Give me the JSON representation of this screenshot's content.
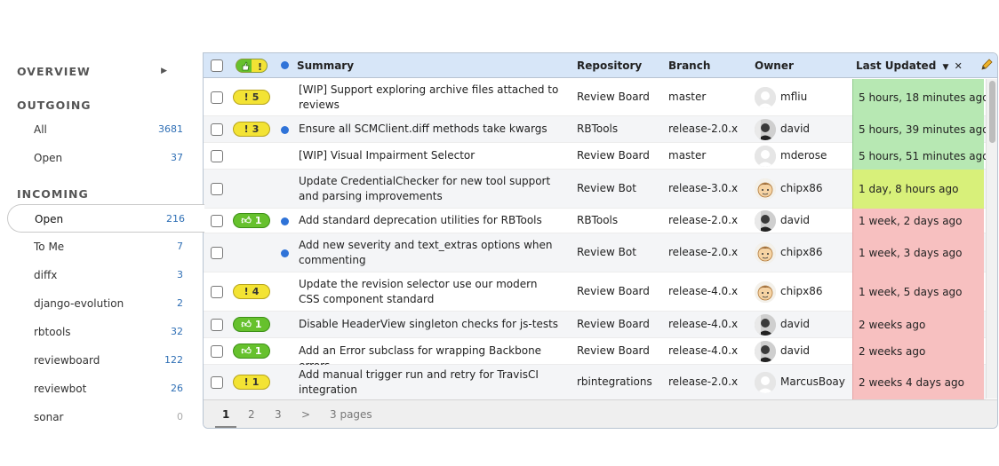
{
  "sidebar": {
    "overview": "OVERVIEW",
    "outgoing": "OUTGOING",
    "incoming": "INCOMING",
    "outgoing_items": [
      {
        "label": "All",
        "count": "3681"
      },
      {
        "label": "Open",
        "count": "37"
      }
    ],
    "incoming_items": [
      {
        "label": "Open",
        "count": "216"
      },
      {
        "label": "To Me",
        "count": "7"
      },
      {
        "label": "diffx",
        "count": "3"
      },
      {
        "label": "django-evolution",
        "count": "2"
      },
      {
        "label": "rbtools",
        "count": "32"
      },
      {
        "label": "reviewboard",
        "count": "122"
      },
      {
        "label": "reviewbot",
        "count": "26"
      },
      {
        "label": "sonar",
        "count": "0"
      }
    ]
  },
  "table": {
    "headers": {
      "summary": "Summary",
      "repository": "Repository",
      "branch": "Branch",
      "owner": "Owner",
      "last_updated": "Last Updated"
    },
    "rows": [
      {
        "badge": "5",
        "badge_color": "yellow",
        "dot": false,
        "summary": "[WIP] Support exploring archive files attached to reviews",
        "summary2": "",
        "repository": "Review Board",
        "branch": "master",
        "owner": "mfliu",
        "avatar": "blank",
        "updated": "5 hours, 18 minutes ago",
        "age": "fresh"
      },
      {
        "badge": "3",
        "badge_color": "yellow",
        "dot": true,
        "summary": "Ensure all SCMClient.diff methods take kwargs",
        "summary2": "",
        "repository": "RBTools",
        "branch": "release-2.0.x",
        "owner": "david",
        "avatar": "photo",
        "updated": "5 hours, 39 minutes ago",
        "age": "fresh"
      },
      {
        "badge": "",
        "badge_color": "",
        "dot": false,
        "summary": "[WIP] Visual Impairment Selector",
        "summary2": "",
        "repository": "Review Board",
        "branch": "master",
        "owner": "mderose",
        "avatar": "blank",
        "updated": "5 hours, 51 minutes ago",
        "age": "fresh"
      },
      {
        "badge": "",
        "badge_color": "",
        "dot": false,
        "summary": "Update CredentialChecker for new tool support and parsing improvements",
        "summary2": "",
        "repository": "Review Bot",
        "branch": "release-3.0.x",
        "owner": "chipx86",
        "avatar": "cartoon",
        "updated": "1 day, 8 hours ago",
        "age": "day"
      },
      {
        "badge": "1",
        "badge_color": "green",
        "dot": true,
        "summary": "Add standard deprecation utilities for RBTools",
        "summary2": "",
        "repository": "RBTools",
        "branch": "release-2.0.x",
        "owner": "david",
        "avatar": "photo",
        "updated": "1 week, 2 days ago",
        "age": "old"
      },
      {
        "badge": "",
        "badge_color": "",
        "dot": true,
        "summary": "Add new severity and text_extras options when commenting",
        "summary2": "",
        "repository": "Review Bot",
        "branch": "release-2.0.x",
        "owner": "chipx86",
        "avatar": "cartoon",
        "updated": "1 week, 3 days ago",
        "age": "old"
      },
      {
        "badge": "4",
        "badge_color": "yellow",
        "dot": false,
        "summary": "Update the revision selector use our modern",
        "summary2": "CSS component standard",
        "repository": "Review Board",
        "branch": "release-4.0.x",
        "owner": "chipx86",
        "avatar": "cartoon",
        "updated": "1 week, 5 days ago",
        "age": "old"
      },
      {
        "badge": "1",
        "badge_color": "green",
        "dot": false,
        "summary": "Disable HeaderView singleton checks for js-tests",
        "summary2": "",
        "repository": "Review Board",
        "branch": "release-4.0.x",
        "owner": "david",
        "avatar": "photo",
        "updated": "2 weeks ago",
        "age": "old"
      },
      {
        "badge": "1",
        "badge_color": "green",
        "dot": false,
        "summary": "Add an Error subclass for wrapping Backbone errors",
        "summary2": "",
        "repository": "Review Board",
        "branch": "release-4.0.x",
        "owner": "david",
        "avatar": "photo",
        "updated": "2 weeks ago",
        "age": "old"
      },
      {
        "badge": "1",
        "badge_color": "yellow",
        "dot": false,
        "summary": "Add manual trigger run and retry for TravisCI integration",
        "summary2": "",
        "repository": "rbintegrations",
        "branch": "release-2.0.x",
        "owner": "MarcusBoay",
        "avatar": "blank",
        "updated": "2 weeks  4 days ago",
        "age": "old"
      }
    ]
  },
  "pagination": {
    "pages": [
      "1",
      "2",
      "3"
    ],
    "next": ">",
    "summary": "3 pages"
  },
  "colors": {
    "fresh": "#b7e8b3",
    "day": "#d8f07a",
    "old": "#f7c0c0",
    "header_bg": "#d7e6f8",
    "link": "#2f6fb5"
  }
}
